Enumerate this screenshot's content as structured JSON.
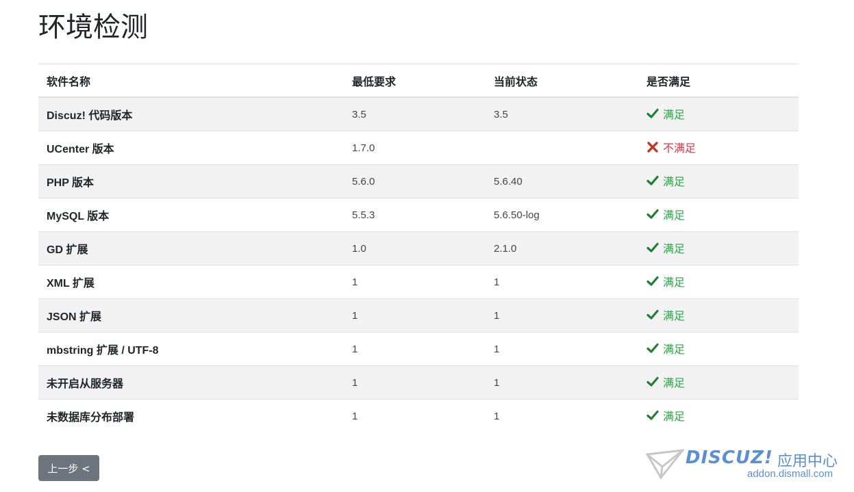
{
  "page": {
    "title": "环境检测"
  },
  "table": {
    "headers": [
      "软件名称",
      "最低要求",
      "当前状态",
      "是否满足"
    ],
    "rows": [
      {
        "name": "Discuz! 代码版本",
        "required": "3.5",
        "current": "3.5",
        "status": "满足",
        "ok": true
      },
      {
        "name": "UCenter 版本",
        "required": "1.7.0",
        "current": "",
        "status": "不满足",
        "ok": false
      },
      {
        "name": "PHP 版本",
        "required": "5.6.0",
        "current": "5.6.40",
        "status": "满足",
        "ok": true
      },
      {
        "name": "MySQL 版本",
        "required": "5.5.3",
        "current": "5.6.50-log",
        "status": "满足",
        "ok": true
      },
      {
        "name": "GD 扩展",
        "required": "1.0",
        "current": "2.1.0",
        "status": "满足",
        "ok": true
      },
      {
        "name": "XML 扩展",
        "required": "1",
        "current": "1",
        "status": "满足",
        "ok": true
      },
      {
        "name": "JSON 扩展",
        "required": "1",
        "current": "1",
        "status": "满足",
        "ok": true
      },
      {
        "name": "mbstring 扩展 / UTF-8",
        "required": "1",
        "current": "1",
        "status": "满足",
        "ok": true
      },
      {
        "name": "未开启从服务器",
        "required": "1",
        "current": "1",
        "status": "满足",
        "ok": true
      },
      {
        "name": "未数据库分布部署",
        "required": "1",
        "current": "1",
        "status": "满足",
        "ok": true
      }
    ]
  },
  "actions": {
    "back_label": "上一步 <"
  },
  "watermark": {
    "brand": "DISCUZ!",
    "sub": "应用中心",
    "url": "addon.dismall.com"
  },
  "colors": {
    "ok": "#28a745",
    "fail": "#dc3545",
    "button": "#6c757d",
    "stripe": "#f2f2f2"
  },
  "icons": {
    "ok": "check-icon",
    "fail": "cross-icon"
  }
}
